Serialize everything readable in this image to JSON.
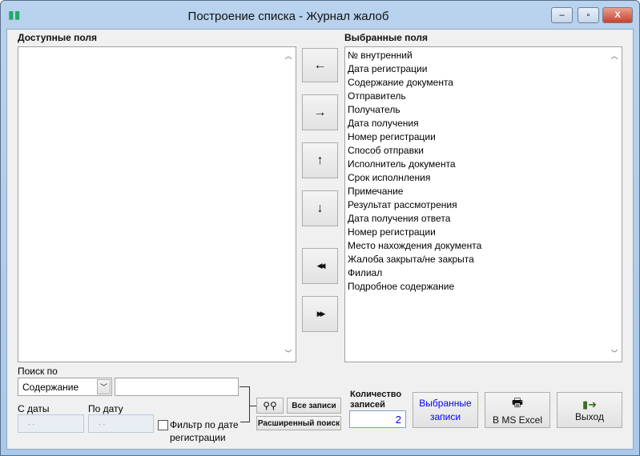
{
  "window": {
    "title": "Построение списка - Журнал жалоб",
    "minimize": "–",
    "maximize": "▫",
    "close": "X"
  },
  "available": {
    "label": "Доступные поля",
    "items": []
  },
  "selected": {
    "label": "Выбранные поля",
    "items": [
      "№ внутренний",
      "Дата регистрации",
      "Содержание документа",
      "Отправитель",
      "Получатель",
      "Дата получения",
      "Номер регистрации",
      "Способ отправки",
      "Исполнитель документа",
      "Срок исполнления",
      "Примечание",
      "Результат рассмотрения",
      "Дата получения ответа",
      "Номер регистрации",
      "Место нахождения документа",
      "Жалоба закрыта/не закрыта",
      "Филиал",
      "Подробное содержание"
    ]
  },
  "move": {
    "left": "←",
    "right": "→",
    "up": "↑",
    "down": "↓",
    "all_left": "◀◀",
    "all_right": "▶▶"
  },
  "search": {
    "label": "Поиск по",
    "field": "Содержание",
    "value": "",
    "from_label": "С даты",
    "to_label": "По дату",
    "from_value": ". .",
    "to_value": ". .",
    "filter_label": "Фильтр по дате регистрации",
    "filter_checked": false,
    "all_records": "Все записи",
    "advanced": "Расширенный поиск"
  },
  "count": {
    "label": "Количество записей",
    "value": "2"
  },
  "actions": {
    "selected_records": "Выбранные записи",
    "excel": "В MS Excel",
    "exit": "Выход"
  },
  "colors": {
    "accent_text": "#0000ff"
  }
}
